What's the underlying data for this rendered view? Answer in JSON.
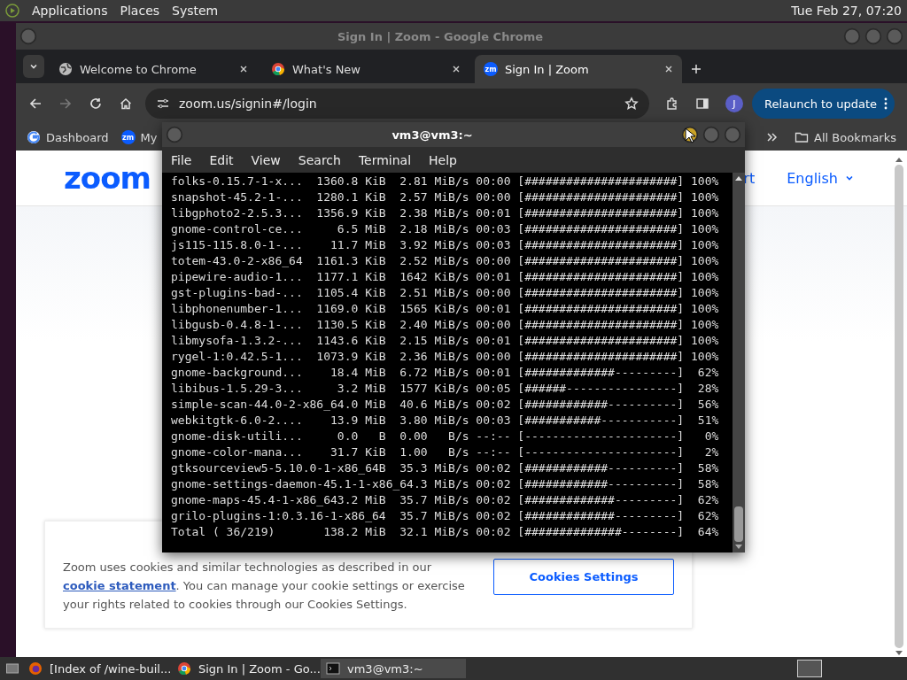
{
  "top_panel": {
    "menus": [
      "Applications",
      "Places",
      "System"
    ],
    "clock": "Tue Feb 27, 07:20"
  },
  "browser": {
    "title": "Sign In | Zoom - Google Chrome",
    "tabs": [
      {
        "label": "Welcome to Chrome",
        "kind": "globe",
        "selected": false
      },
      {
        "label": "What's New",
        "kind": "chrome",
        "selected": false
      },
      {
        "label": "Sign In | Zoom",
        "kind": "zoom",
        "favicon_text": "zm",
        "selected": true
      }
    ],
    "address": "zoom.us/signin#/login",
    "profile": "J",
    "relaunch": "Relaunch to update",
    "bookmarks": [
      {
        "label": "Dashboard",
        "kind": "google"
      },
      {
        "label": "My",
        "kind": "zoom",
        "favicon_text": "zm"
      }
    ],
    "all_bookmarks": "All Bookmarks",
    "page": {
      "logo": "zoom",
      "nav_link": "rt",
      "language": "English",
      "cookie_text_before": "Zoom uses cookies and similar technologies as described in our ",
      "cookie_link": "cookie statement",
      "cookie_text_after": ". You can manage your cookie settings or exercise your rights related to cookies through our Cookies Settings.",
      "cookies_button": "Cookies Settings"
    }
  },
  "terminal": {
    "title": "vm3@vm3:~",
    "menus": [
      "File",
      "Edit",
      "View",
      "Search",
      "Terminal",
      "Help"
    ],
    "lines": [
      "folks-0.15.7-1-x...  1360.8 KiB  2.81 MiB/s 00:00 [######################] 100%",
      "snapshot-45.2-1-...  1280.1 KiB  2.57 MiB/s 00:00 [######################] 100%",
      "libgphoto2-2.5.3...  1356.9 KiB  2.38 MiB/s 00:01 [######################] 100%",
      "gnome-control-ce...     6.5 MiB  2.18 MiB/s 00:03 [######################] 100%",
      "js115-115.8.0-1-...    11.7 MiB  3.92 MiB/s 00:03 [######################] 100%",
      "totem-43.0-2-x86_64  1161.3 KiB  2.52 MiB/s 00:00 [######################] 100%",
      "pipewire-audio-1...  1177.1 KiB  1642 KiB/s 00:01 [######################] 100%",
      "gst-plugins-bad-...  1105.4 KiB  2.51 MiB/s 00:00 [######################] 100%",
      "libphonenumber-1...  1169.0 KiB  1565 KiB/s 00:01 [######################] 100%",
      "libgusb-0.4.8-1-...  1130.5 KiB  2.40 MiB/s 00:00 [######################] 100%",
      "libmysofa-1.3.2-...  1143.6 KiB  2.15 MiB/s 00:01 [######################] 100%",
      "rygel-1:0.42.5-1...  1073.9 KiB  2.36 MiB/s 00:00 [######################] 100%",
      "gnome-background...    18.4 MiB  6.72 MiB/s 00:01 [#############---------]  62%",
      "libibus-1.5.29-3...     3.2 MiB  1577 KiB/s 00:05 [######----------------]  28%",
      "simple-scan-44.0-2-x86_64.0 MiB  40.6 MiB/s 00:02 [############----------]  56%",
      "webkitgtk-6.0-2....    13.9 MiB  3.80 MiB/s 00:03 [###########-----------]  51%",
      "gnome-disk-utili...     0.0   B  0.00   B/s --:-- [----------------------]   0%",
      "gnome-color-mana...    31.7 KiB  1.00   B/s --:-- [----------------------]   2%",
      "gtksourceview5-5.10.0-1-x86_64B  35.3 MiB/s 00:02 [############----------]  58%",
      "gnome-settings-daemon-45.1-1-x86_64.3 MiB/s 00:02 [############----------]  58%",
      "gnome-maps-45.4-1-x86_643.2 MiB  35.7 MiB/s 00:02 [#############---------]  62%",
      "grilo-plugins-1:0.3.16-1-x86_64  35.7 MiB/s 00:02 [#############---------]  62%",
      "Total ( 36/219)       138.2 MiB  32.1 MiB/s 00:02 [##############--------]  64%"
    ]
  },
  "taskbar": {
    "items": [
      {
        "label": "[Index of /wine-buil...",
        "kind": "firefox",
        "selected": false
      },
      {
        "label": "Sign In | Zoom - Go...",
        "kind": "chrome",
        "selected": false
      },
      {
        "label": "vm3@vm3:~",
        "kind": "terminal",
        "selected": true
      }
    ]
  }
}
